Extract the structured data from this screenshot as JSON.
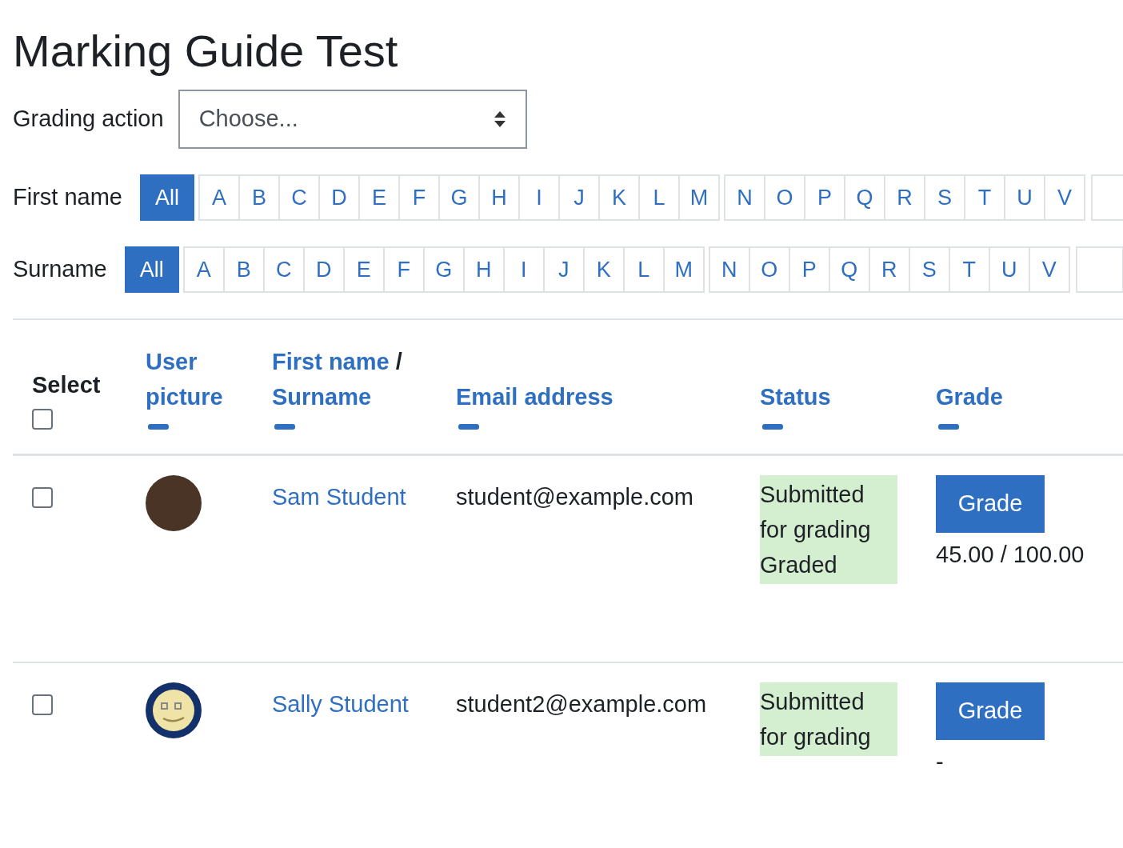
{
  "title": "Marking Guide Test",
  "grading_action": {
    "label": "Grading action",
    "value": "Choose..."
  },
  "filters": [
    {
      "label": "First name",
      "groups": [
        [
          {
            "label": "All",
            "selected": true
          },
          {
            "label": "A",
            "selected": false
          },
          {
            "label": "B",
            "selected": false
          },
          {
            "label": "C",
            "selected": false
          },
          {
            "label": "D",
            "selected": false
          },
          {
            "label": "E",
            "selected": false
          },
          {
            "label": "F",
            "selected": false
          },
          {
            "label": "G",
            "selected": false
          },
          {
            "label": "H",
            "selected": false
          },
          {
            "label": "I",
            "selected": false
          },
          {
            "label": "J",
            "selected": false
          },
          {
            "label": "K",
            "selected": false
          },
          {
            "label": "L",
            "selected": false
          },
          {
            "label": "M",
            "selected": false
          }
        ],
        [
          {
            "label": "N",
            "selected": false
          },
          {
            "label": "O",
            "selected": false
          },
          {
            "label": "P",
            "selected": false
          },
          {
            "label": "Q",
            "selected": false
          },
          {
            "label": "R",
            "selected": false
          },
          {
            "label": "S",
            "selected": false
          },
          {
            "label": "T",
            "selected": false
          },
          {
            "label": "U",
            "selected": false
          },
          {
            "label": "V",
            "selected": false
          }
        ]
      ]
    },
    {
      "label": "Surname",
      "groups": [
        [
          {
            "label": "All",
            "selected": true
          },
          {
            "label": "A",
            "selected": false
          },
          {
            "label": "B",
            "selected": false
          },
          {
            "label": "C",
            "selected": false
          },
          {
            "label": "D",
            "selected": false
          },
          {
            "label": "E",
            "selected": false
          },
          {
            "label": "F",
            "selected": false
          },
          {
            "label": "G",
            "selected": false
          },
          {
            "label": "H",
            "selected": false
          },
          {
            "label": "I",
            "selected": false
          },
          {
            "label": "J",
            "selected": false
          },
          {
            "label": "K",
            "selected": false
          },
          {
            "label": "L",
            "selected": false
          },
          {
            "label": "M",
            "selected": false
          }
        ],
        [
          {
            "label": "N",
            "selected": false
          },
          {
            "label": "O",
            "selected": false
          },
          {
            "label": "P",
            "selected": false
          },
          {
            "label": "Q",
            "selected": false
          },
          {
            "label": "R",
            "selected": false
          },
          {
            "label": "S",
            "selected": false
          },
          {
            "label": "T",
            "selected": false
          },
          {
            "label": "U",
            "selected": false
          },
          {
            "label": "V",
            "selected": false
          }
        ]
      ]
    }
  ],
  "table": {
    "select_header": {
      "label": "Select",
      "checked": false
    },
    "columns": [
      {
        "label": "User picture"
      },
      {
        "label": "First name",
        "separator": "/",
        "label2": "Surname"
      },
      {
        "label": "Email address"
      },
      {
        "label": "Status"
      },
      {
        "label": "Grade"
      }
    ],
    "rows": [
      {
        "checked": false,
        "kind": "photo",
        "name": "Sam Student",
        "email": "student@example.com",
        "status": [
          "Submitted for grading",
          "Graded"
        ],
        "button": "Grade",
        "grade": "45.00 / 100.00"
      },
      {
        "checked": false,
        "kind": "smiley",
        "name": "Sally Student",
        "email": "student2@example.com",
        "status": [
          "Submitted for grading"
        ],
        "button": "Grade",
        "grade": "-"
      }
    ]
  }
}
